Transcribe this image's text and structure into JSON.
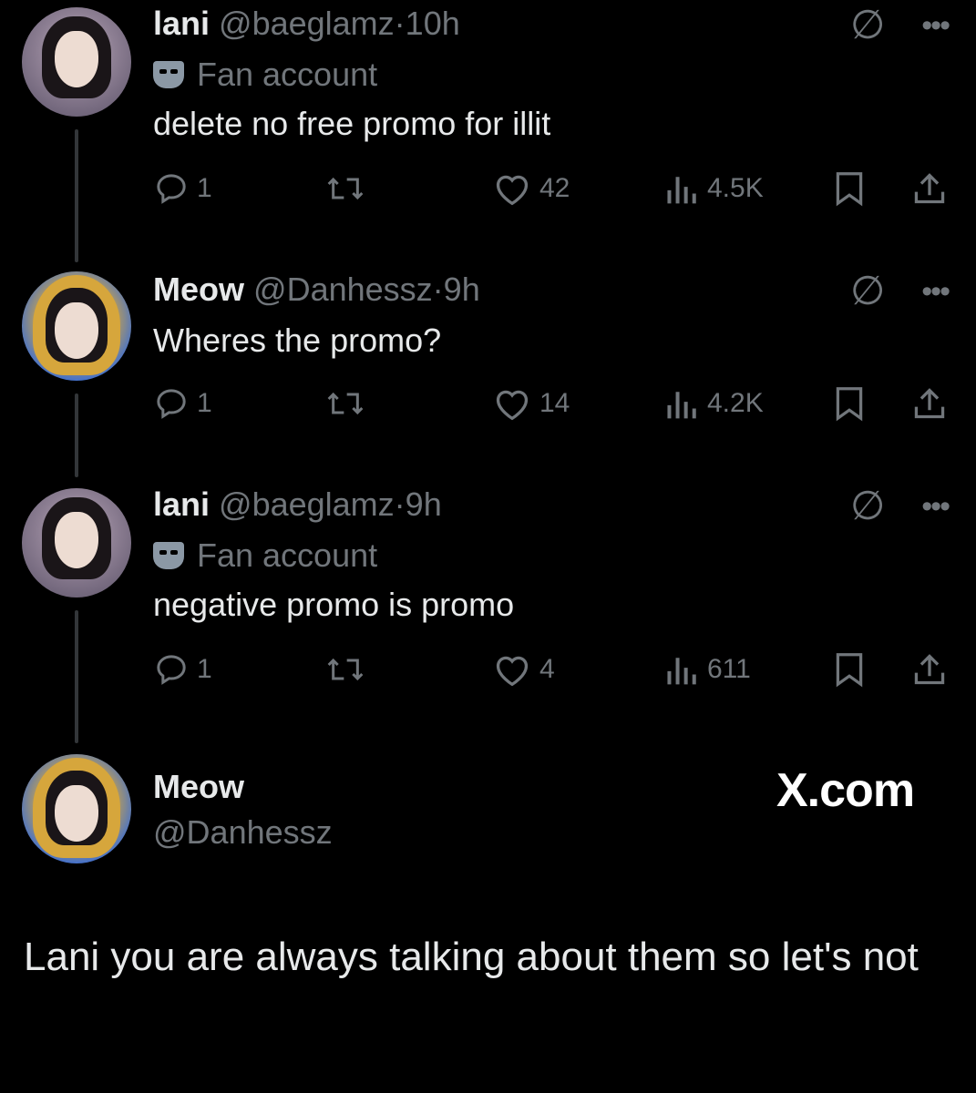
{
  "tweets": [
    {
      "name": "lani",
      "handle": "@baeglamz",
      "dot": "·",
      "time": "10h",
      "label": "Fan account",
      "text": "delete no free promo for illit",
      "replies": "1",
      "likes": "42",
      "views": "4.5K"
    },
    {
      "name": "Meow",
      "handle": "@Danhessz",
      "dot": "·",
      "time": "9h",
      "text": "Wheres the promo?",
      "replies": "1",
      "likes": "14",
      "views": "4.2K"
    },
    {
      "name": "lani",
      "handle": "@baeglamz",
      "dot": "·",
      "time": "9h",
      "label": "Fan account",
      "text": "negative promo is promo",
      "replies": "1",
      "likes": "4",
      "views": "611"
    }
  ],
  "final": {
    "name": "Meow",
    "handle": "@Danhessz",
    "brand": "X.com",
    "text": "Lani you are always talking about them so let's not"
  },
  "icons": {
    "grok": "grok-icon",
    "more": "more-icon",
    "reply": "reply-icon",
    "retweet": "retweet-icon",
    "like": "heart-icon",
    "views": "views-icon",
    "bookmark": "bookmark-icon",
    "share": "share-icon"
  },
  "colors": {
    "background": "#000000",
    "text": "#e7e9ea",
    "muted": "#71767b"
  }
}
